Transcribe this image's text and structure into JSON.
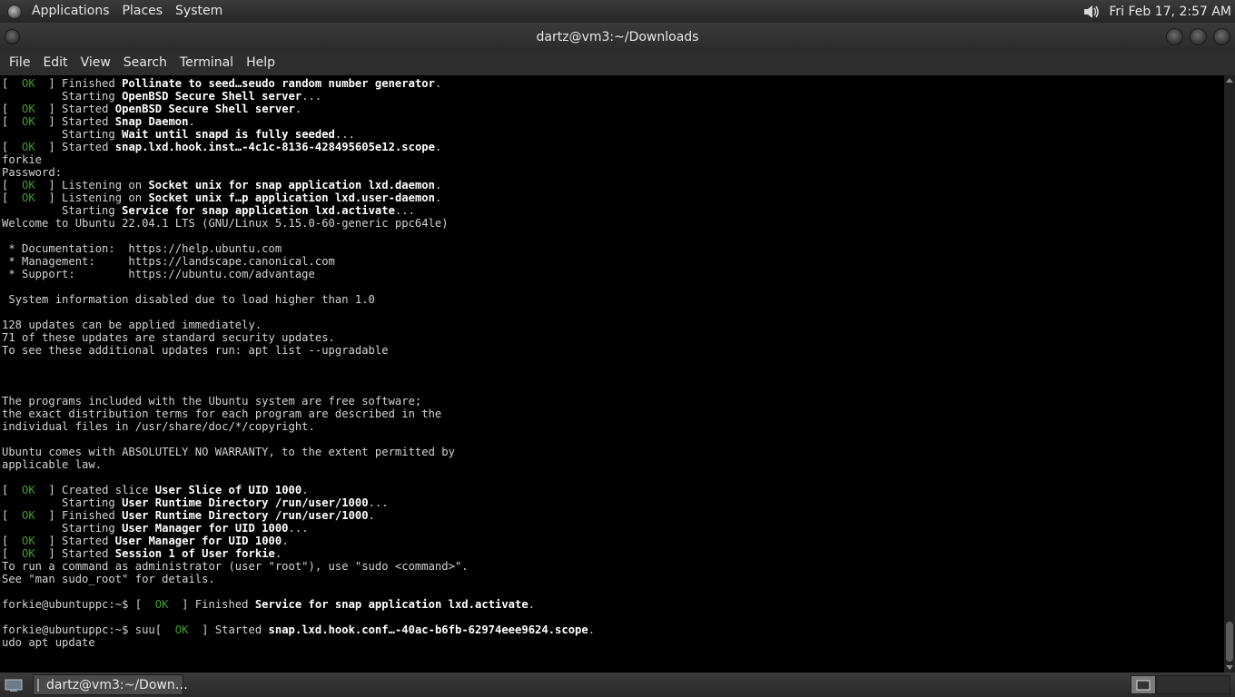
{
  "top_panel": {
    "menus": [
      "Applications",
      "Places",
      "System"
    ],
    "clock": "Fri Feb 17,  2:57 AM"
  },
  "window": {
    "title": "dartz@vm3:~/Downloads"
  },
  "menu_bar": {
    "items": [
      "File",
      "Edit",
      "View",
      "Search",
      "Terminal",
      "Help"
    ]
  },
  "terminal": {
    "lines": [
      [
        [
          "[  ",
          ""
        ],
        [
          "OK",
          "ok"
        ],
        [
          "  ] Finished ",
          ""
        ],
        [
          "Pollinate to seed…seudo random number generator",
          "hl"
        ],
        [
          ".",
          ""
        ]
      ],
      [
        [
          "         Starting ",
          ""
        ],
        [
          "OpenBSD Secure Shell server",
          "hl"
        ],
        [
          "...",
          ""
        ]
      ],
      [
        [
          "[  ",
          ""
        ],
        [
          "OK",
          "ok"
        ],
        [
          "  ] Started ",
          ""
        ],
        [
          "OpenBSD Secure Shell server",
          "hl"
        ],
        [
          ".",
          ""
        ]
      ],
      [
        [
          "[  ",
          ""
        ],
        [
          "OK",
          "ok"
        ],
        [
          "  ] Started ",
          ""
        ],
        [
          "Snap Daemon",
          "hl"
        ],
        [
          ".",
          ""
        ]
      ],
      [
        [
          "         Starting ",
          ""
        ],
        [
          "Wait until snapd is fully seeded",
          "hl"
        ],
        [
          "...",
          ""
        ]
      ],
      [
        [
          "[  ",
          ""
        ],
        [
          "OK",
          "ok"
        ],
        [
          "  ] Started ",
          ""
        ],
        [
          "snap.lxd.hook.inst…-4c1c-8136-428495605e12.scope",
          "hl"
        ],
        [
          ".",
          ""
        ]
      ],
      [
        [
          "forkie",
          ""
        ]
      ],
      [
        [
          "Password:",
          ""
        ]
      ],
      [
        [
          "[  ",
          ""
        ],
        [
          "OK",
          "ok"
        ],
        [
          "  ] Listening on ",
          ""
        ],
        [
          "Socket unix for snap application lxd.daemon",
          "hl"
        ],
        [
          ".",
          ""
        ]
      ],
      [
        [
          "[  ",
          ""
        ],
        [
          "OK",
          "ok"
        ],
        [
          "  ] Listening on ",
          ""
        ],
        [
          "Socket unix f…p application lxd.user-daemon",
          "hl"
        ],
        [
          ".",
          ""
        ]
      ],
      [
        [
          "         Starting ",
          ""
        ],
        [
          "Service for snap application lxd.activate",
          "hl"
        ],
        [
          "...",
          ""
        ]
      ],
      [
        [
          "Welcome to Ubuntu 22.04.1 LTS (GNU/Linux 5.15.0-60-generic ppc64le)",
          ""
        ]
      ],
      [
        [
          "",
          ""
        ]
      ],
      [
        [
          " * Documentation:  https://help.ubuntu.com",
          ""
        ]
      ],
      [
        [
          " * Management:     https://landscape.canonical.com",
          ""
        ]
      ],
      [
        [
          " * Support:        https://ubuntu.com/advantage",
          ""
        ]
      ],
      [
        [
          "",
          ""
        ]
      ],
      [
        [
          " System information disabled due to load higher than 1.0",
          ""
        ]
      ],
      [
        [
          "",
          ""
        ]
      ],
      [
        [
          "128 updates can be applied immediately.",
          ""
        ]
      ],
      [
        [
          "71 of these updates are standard security updates.",
          ""
        ]
      ],
      [
        [
          "To see these additional updates run: apt list --upgradable",
          ""
        ]
      ],
      [
        [
          "",
          ""
        ]
      ],
      [
        [
          "",
          ""
        ]
      ],
      [
        [
          "",
          ""
        ]
      ],
      [
        [
          "The programs included with the Ubuntu system are free software;",
          ""
        ]
      ],
      [
        [
          "the exact distribution terms for each program are described in the",
          ""
        ]
      ],
      [
        [
          "individual files in /usr/share/doc/*/copyright.",
          ""
        ]
      ],
      [
        [
          "",
          ""
        ]
      ],
      [
        [
          "Ubuntu comes with ABSOLUTELY NO WARRANTY, to the extent permitted by",
          ""
        ]
      ],
      [
        [
          "applicable law.",
          ""
        ]
      ],
      [
        [
          "",
          ""
        ]
      ],
      [
        [
          "[  ",
          ""
        ],
        [
          "OK",
          "ok"
        ],
        [
          "  ] Created slice ",
          ""
        ],
        [
          "User Slice of UID 1000",
          "hl"
        ],
        [
          ".",
          ""
        ]
      ],
      [
        [
          "         Starting ",
          ""
        ],
        [
          "User Runtime Directory /run/user/1000",
          "hl"
        ],
        [
          "...",
          ""
        ]
      ],
      [
        [
          "[  ",
          ""
        ],
        [
          "OK",
          "ok"
        ],
        [
          "  ] Finished ",
          ""
        ],
        [
          "User Runtime Directory /run/user/1000",
          "hl"
        ],
        [
          ".",
          ""
        ]
      ],
      [
        [
          "         Starting ",
          ""
        ],
        [
          "User Manager for UID 1000",
          "hl"
        ],
        [
          "...",
          ""
        ]
      ],
      [
        [
          "[  ",
          ""
        ],
        [
          "OK",
          "ok"
        ],
        [
          "  ] Started ",
          ""
        ],
        [
          "User Manager for UID 1000",
          "hl"
        ],
        [
          ".",
          ""
        ]
      ],
      [
        [
          "[  ",
          ""
        ],
        [
          "OK",
          "ok"
        ],
        [
          "  ] Started ",
          ""
        ],
        [
          "Session 1 of User forkie",
          "hl"
        ],
        [
          ".",
          ""
        ]
      ],
      [
        [
          "To run a command as administrator (user \"root\"), use \"sudo <command>\".",
          ""
        ]
      ],
      [
        [
          "See \"man sudo_root\" for details.",
          ""
        ]
      ],
      [
        [
          "",
          ""
        ]
      ],
      [
        [
          "forkie@ubuntuppc:~$ [  ",
          ""
        ],
        [
          "OK",
          "ok"
        ],
        [
          "  ] Finished ",
          ""
        ],
        [
          "Service for snap application lxd.activate",
          "hl"
        ],
        [
          ".",
          ""
        ]
      ],
      [
        [
          "",
          ""
        ]
      ],
      [
        [
          "forkie@ubuntuppc:~$ suu[  ",
          ""
        ],
        [
          "OK",
          "ok"
        ],
        [
          "  ] Started ",
          ""
        ],
        [
          "snap.lxd.hook.conf…-40ac-b6fb-62974eee9624.scope",
          "hl"
        ],
        [
          ".",
          ""
        ]
      ],
      [
        [
          "udo apt update",
          ""
        ]
      ]
    ]
  },
  "scrollbar": {
    "thumb_start_fraction": 0.93,
    "thumb_size_fraction": 0.07
  },
  "taskbar": {
    "task_label": "dartz@vm3:~/Down…"
  }
}
